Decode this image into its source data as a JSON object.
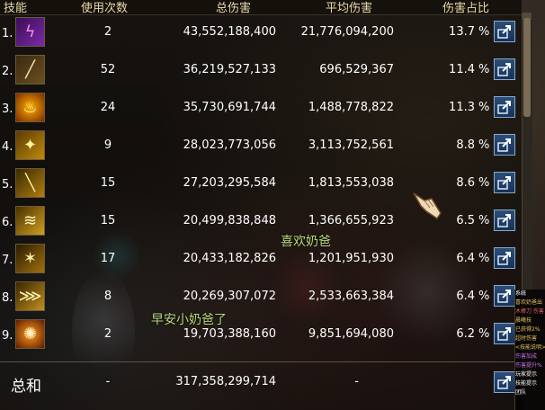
{
  "header": {
    "col_skill": "技能",
    "col_uses": "使用次数",
    "col_total": "总伤害",
    "col_avg": "平均伤害",
    "col_pct": "伤害占比"
  },
  "rows": [
    {
      "rank": "1.",
      "icon": "purple-lightning-skill-icon",
      "uses": "2",
      "total": "43,552,188,400",
      "avg": "21,776,094,200",
      "pct": "13.7",
      "pct_sign": "%"
    },
    {
      "rank": "2.",
      "icon": "bone-club-skill-icon",
      "uses": "52",
      "total": "36,219,527,133",
      "avg": "696,529,367",
      "pct": "11.4",
      "pct_sign": "%"
    },
    {
      "rank": "3.",
      "icon": "flame-burst-skill-icon",
      "uses": "24",
      "total": "35,730,691,744",
      "avg": "1,488,778,822",
      "pct": "11.3",
      "pct_sign": "%"
    },
    {
      "rank": "4.",
      "icon": "golden-stars-skill-icon",
      "uses": "9",
      "total": "28,023,773,056",
      "avg": "3,113,752,561",
      "pct": "8.8",
      "pct_sign": "%"
    },
    {
      "rank": "5.",
      "icon": "golden-sword-skill-icon",
      "uses": "15",
      "total": "27,203,295,584",
      "avg": "1,813,553,038",
      "pct": "8.6",
      "pct_sign": "%"
    },
    {
      "rank": "6.",
      "icon": "golden-wave-skill-icon",
      "uses": "15",
      "total": "20,499,838,848",
      "avg": "1,366,655,923",
      "pct": "6.5",
      "pct_sign": "%"
    },
    {
      "rank": "7.",
      "icon": "golden-spark-skill-icon",
      "uses": "17",
      "total": "20,433,182,826",
      "avg": "1,201,951,930",
      "pct": "6.4",
      "pct_sign": "%"
    },
    {
      "rank": "8.",
      "icon": "golden-rays-skill-icon",
      "uses": "8",
      "total": "20,269,307,072",
      "avg": "2,533,663,384",
      "pct": "6.4",
      "pct_sign": "%"
    },
    {
      "rank": "9.",
      "icon": "orange-orb-skill-icon",
      "uses": "2",
      "total": "19,703,388,160",
      "avg": "9,851,694,080",
      "pct": "6.2",
      "pct_sign": "%"
    }
  ],
  "summary": {
    "label": "总和",
    "uses": "-",
    "total": "317,358,299,714",
    "avg": "-"
  },
  "overlay_texts": {
    "name_1": "喜欢奶爸",
    "name_2": "早安小奶爸了"
  },
  "side_chat": [
    {
      "text": "系统",
      "color": "#ffffff"
    },
    {
      "text": "喜欢奶爸出",
      "color": "#e6c06a"
    },
    {
      "text": "木棒刀 伤害",
      "color": "#e06060"
    },
    {
      "text": "晨曦技",
      "color": "#e0c060"
    },
    {
      "text": "已获得2%",
      "color": "#e0c060"
    },
    {
      "text": "超时伤害",
      "color": "#e0c060"
    },
    {
      "text": "<技能说明>",
      "color": "#e0c060"
    },
    {
      "text": "伤害加成",
      "color": "#c070e0"
    },
    {
      "text": "伤害提升%",
      "color": "#c070e0"
    },
    {
      "text": "玩家提示",
      "color": "#ffffff"
    },
    {
      "text": "技能提示",
      "color": "#ffffff"
    },
    {
      "text": "团队",
      "color": "#ffffff"
    }
  ],
  "colors": {
    "header_text": "#e8d9a8",
    "share_button": "#2a4e79",
    "overlay_name": "#b7d97a"
  }
}
